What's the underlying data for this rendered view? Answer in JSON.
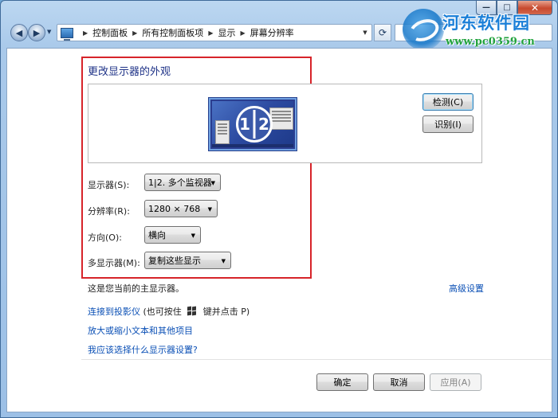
{
  "window": {
    "minimize_glyph": "—",
    "maximize_glyph": "□",
    "close_glyph": "✕"
  },
  "nav": {
    "back_glyph": "◀",
    "forward_glyph": "▶",
    "dropdown_glyph": "▼",
    "refresh_glyph": "⟳",
    "breadcrumbs": [
      "控制面板",
      "所有控制面板项",
      "显示",
      "屏幕分辨率"
    ],
    "separator": "▶"
  },
  "watermark": {
    "title": "河东软件园",
    "url": "www.pc0359.cn"
  },
  "main": {
    "title": "更改显示器的外观",
    "monitor_numbers": [
      "1",
      "2"
    ],
    "detect_button": "检测(C)",
    "identify_button": "识别(I)",
    "fields": {
      "display": {
        "label": "显示器(S):",
        "value": "1|2. 多个监视器"
      },
      "resolution": {
        "label": "分辨率(R):",
        "value": "1280 × 768"
      },
      "orientation": {
        "label": "方向(O):",
        "value": "横向"
      },
      "multiple": {
        "label": "多显示器(M):",
        "value": "复制这些显示"
      }
    },
    "primary_note": "这是您当前的主显示器。",
    "advanced_link": "高级设置",
    "projector_link": "连接到投影仪",
    "projector_hint_pre": "(也可按住",
    "projector_hint_post": "键并点击 P)",
    "text_size_link": "放大或缩小文本和其他项目",
    "help_link": "我应该选择什么显示器设置?"
  },
  "footer": {
    "ok": "确定",
    "cancel": "取消",
    "apply": "应用(A)"
  },
  "colors": {
    "highlight_border": "#d7242a",
    "link": "#0a4fb5",
    "title": "#1e3287"
  }
}
